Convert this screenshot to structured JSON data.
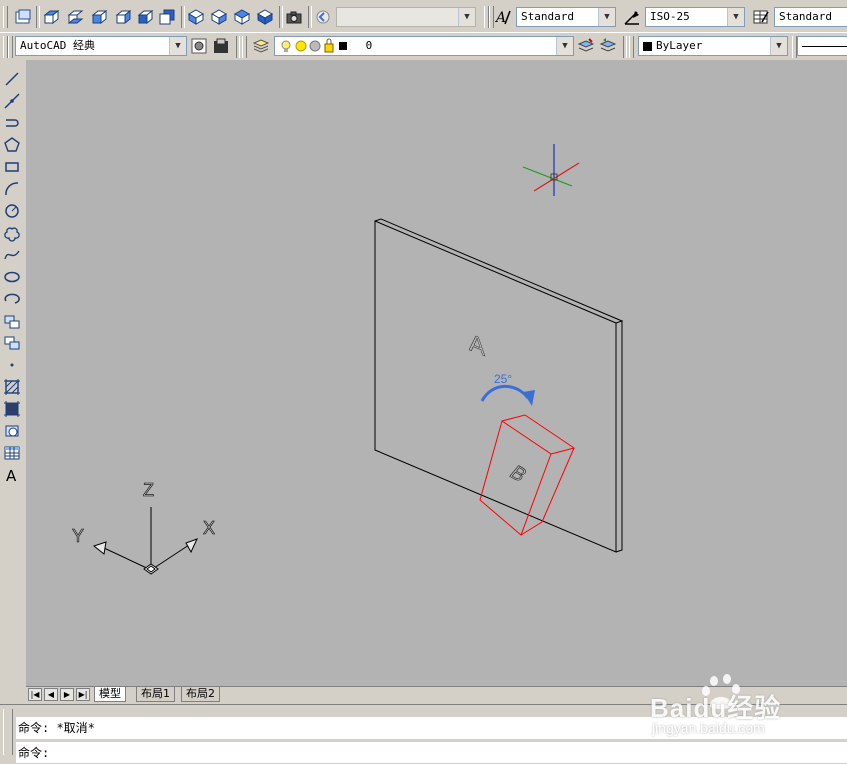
{
  "toolbar1": {
    "disabled_combo_value": "",
    "text_style": "Standard",
    "dim_style": "ISO-25",
    "table_style": "Standard"
  },
  "toolbar2": {
    "workspace": "AutoCAD 经典",
    "layer_name": "0",
    "color": "ByLayer"
  },
  "viewport": {
    "label_a": "A",
    "label_b": "B",
    "angle_label": "25°",
    "ucs_x": "X",
    "ucs_y": "Y",
    "ucs_z": "Z"
  },
  "tabs": {
    "model": "模型",
    "layout1": "布局1",
    "layout2": "布局2"
  },
  "command": {
    "history": "命令: *取消*",
    "prompt": "命令:"
  },
  "watermark": {
    "brand": "Baidu经验",
    "url": "jingyan.baidu.com"
  },
  "colors": {
    "canvas_bg": "#b3b3b3",
    "selection": "#ff0000",
    "annotation": "#3a6fd8"
  }
}
